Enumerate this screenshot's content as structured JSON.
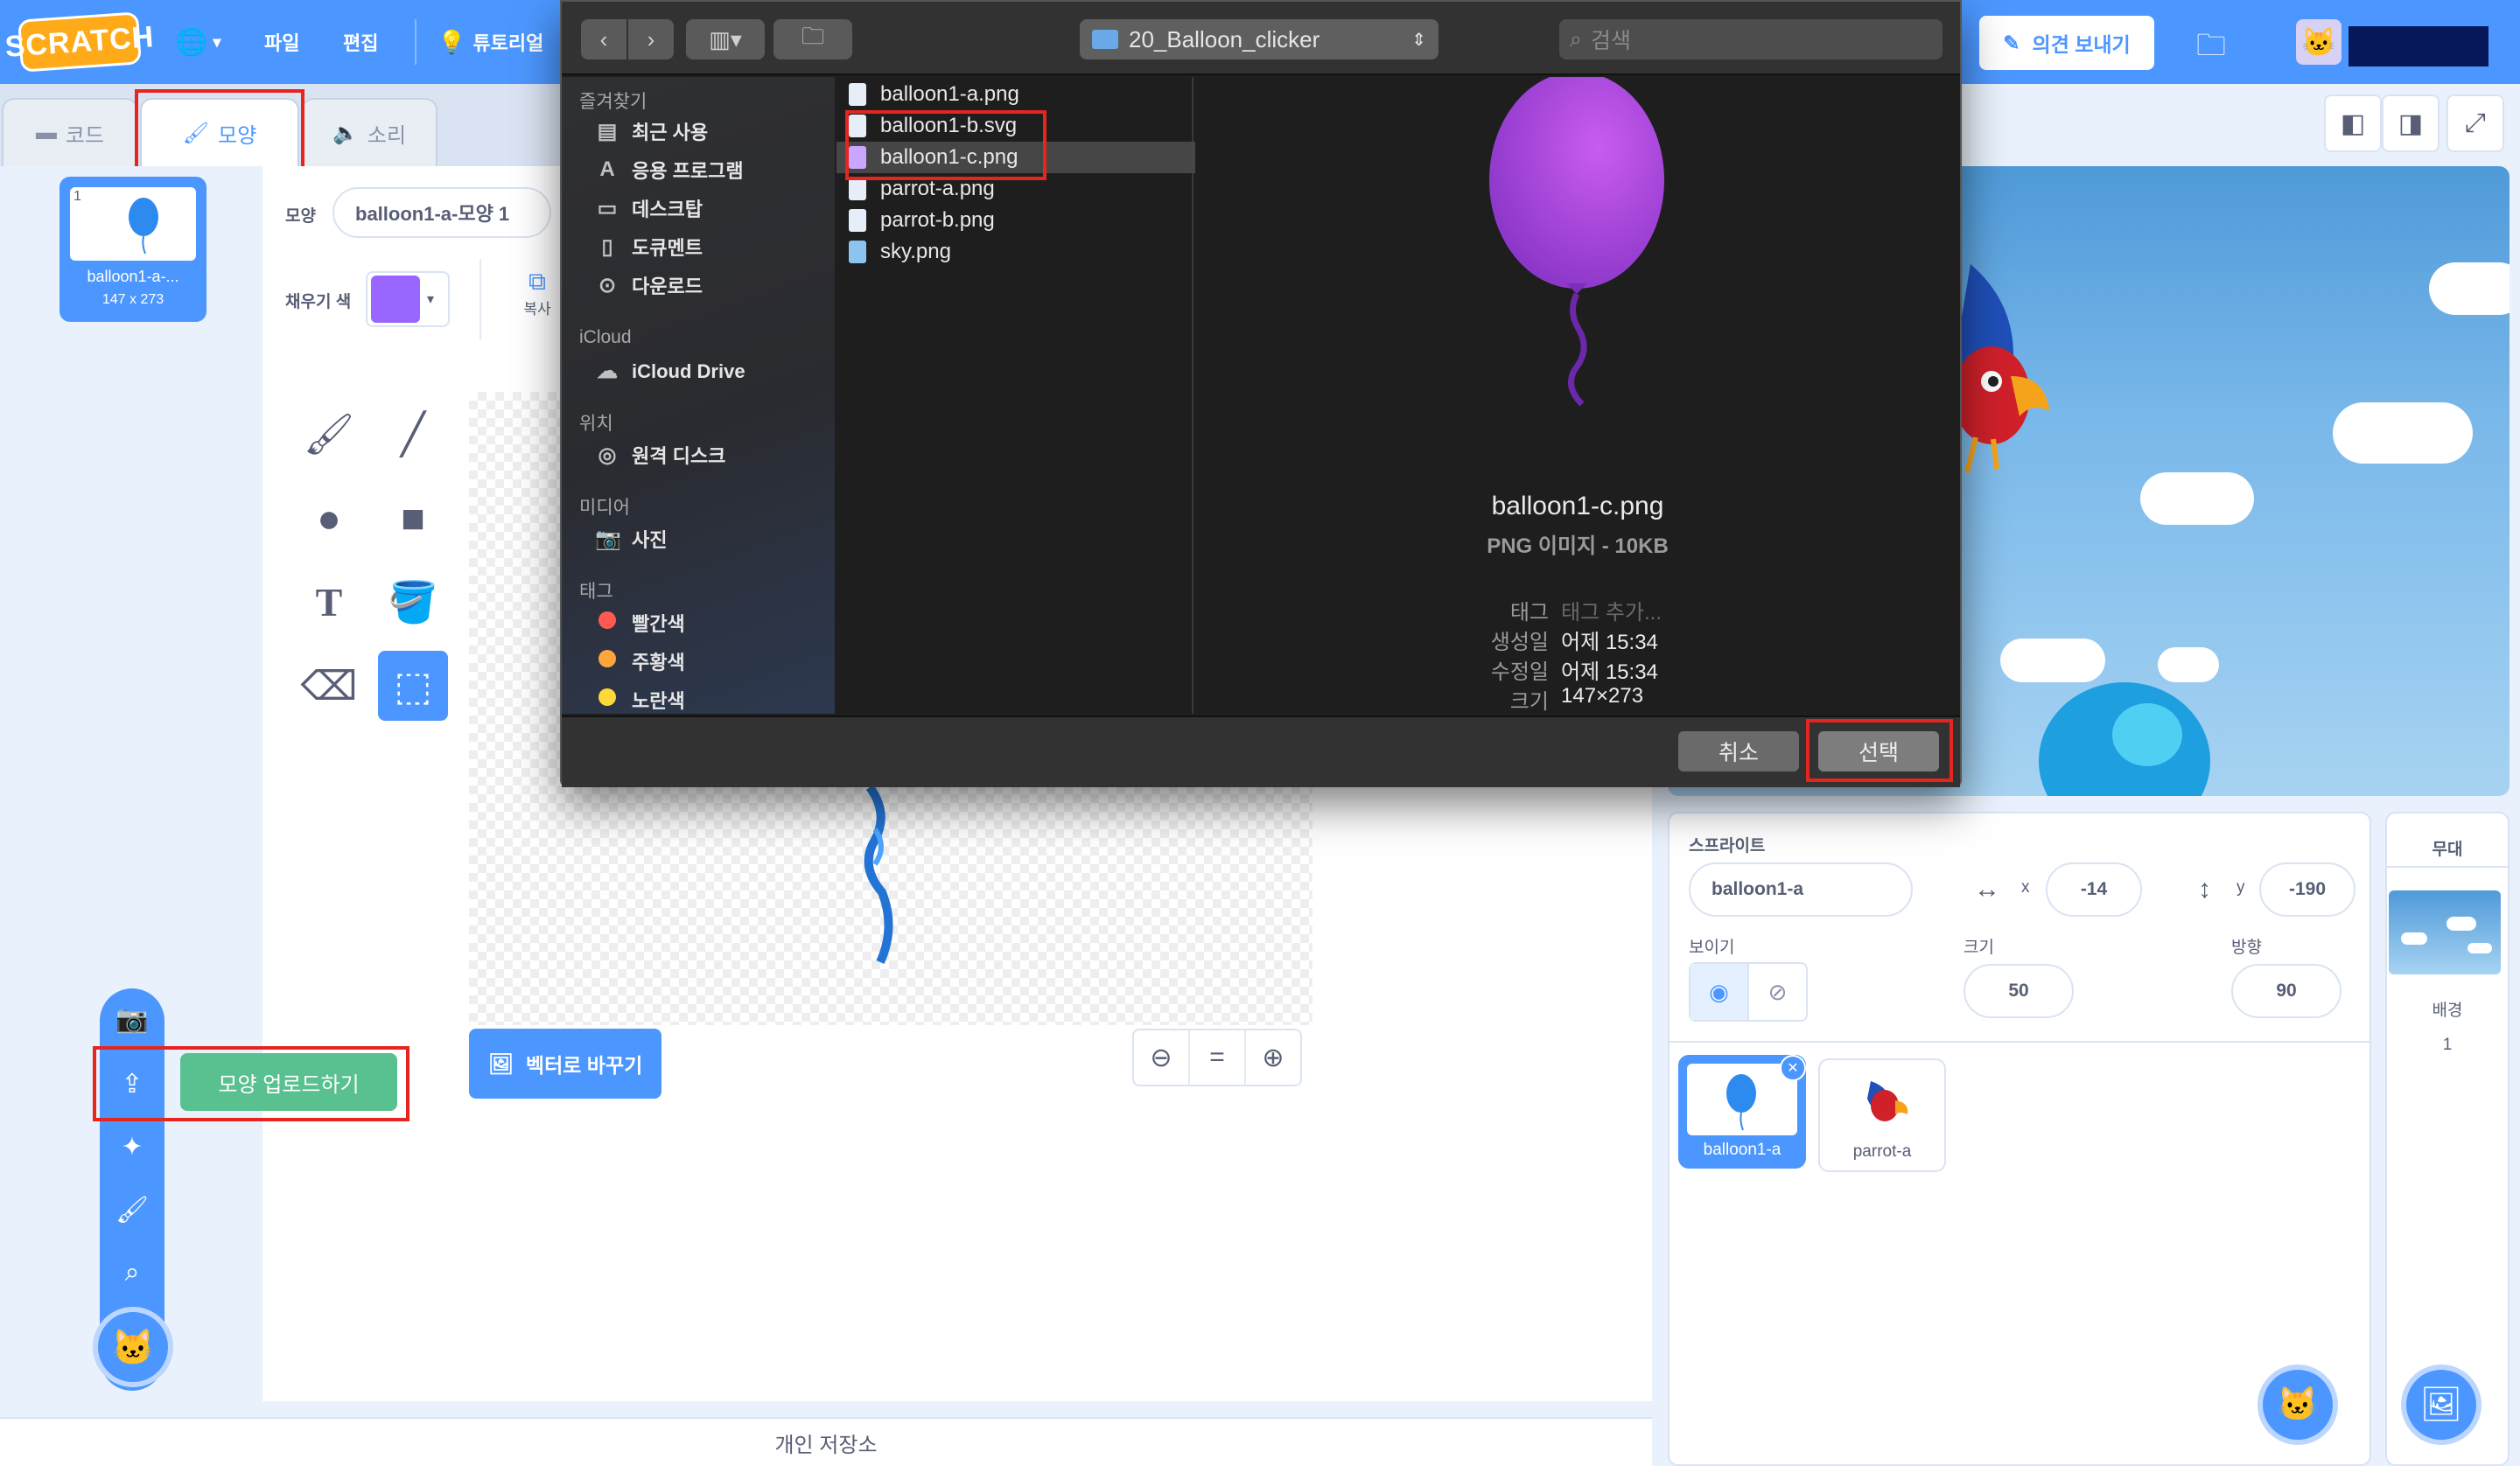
{
  "menubar": {
    "logo": "SCRATCH",
    "file": "파일",
    "edit": "편집",
    "tutorials": "튜토리얼",
    "feedback": "의견 보내기"
  },
  "tabs": {
    "code": "코드",
    "costumes": "모양",
    "sounds": "소리"
  },
  "costume_list": [
    {
      "index": "1",
      "name": "balloon1-a-...",
      "size": "147 x 273"
    }
  ],
  "paint": {
    "costume_label": "모양",
    "costume_name": "balloon1-a-모양 1",
    "fill_label": "채우기 색",
    "fill_color": "#9966ff",
    "copy_label": "복사",
    "convert_button": "벡터로 바꾸기",
    "zoom_reset": "="
  },
  "upload_menu": {
    "tooltip": "모양 업로드하기"
  },
  "backpack": "개인 저장소",
  "sprite_info": {
    "sprite_label": "스프라이트",
    "sprite_name": "balloon1-a",
    "x_label": "x",
    "x_value": "-14",
    "y_label": "y",
    "y_value": "-190",
    "show_label": "보이기",
    "size_label": "크기",
    "size_value": "50",
    "direction_label": "방향",
    "direction_value": "90"
  },
  "sprites": [
    {
      "name": "balloon1-a",
      "selected": true
    },
    {
      "name": "parrot-a",
      "selected": false
    }
  ],
  "stage_panel": {
    "title": "무대",
    "backdrop_label": "배경",
    "backdrop_count": "1"
  },
  "dialog": {
    "folder": "20_Balloon_clicker",
    "search_placeholder": "검색",
    "favorites_header": "즐겨찾기",
    "favorites": [
      "최근 사용",
      "응용 프로그램",
      "데스크탑",
      "도큐멘트",
      "다운로드"
    ],
    "icloud_header": "iCloud",
    "icloud_items": [
      "iCloud Drive"
    ],
    "locations_header": "위치",
    "locations": [
      "원격 디스크"
    ],
    "media_header": "미디어",
    "media": [
      "사진"
    ],
    "tags_header": "태그",
    "tags": [
      {
        "name": "빨간색",
        "color": "#ff5a52"
      },
      {
        "name": "주황색",
        "color": "#ffa53c"
      },
      {
        "name": "노란색",
        "color": "#ffd83a"
      }
    ],
    "files": [
      "balloon1-a.png",
      "balloon1-b.svg",
      "balloon1-c.png",
      "parrot-a.png",
      "parrot-b.png",
      "sky.png"
    ],
    "selected_file": "balloon1-c.png",
    "preview": {
      "name": "balloon1-c.png",
      "kind": "PNG 이미지 - 10KB",
      "tag_label": "태그",
      "tag_value": "태그 추가...",
      "created_label": "생성일",
      "created_value": "어제 15:34",
      "modified_label": "수정일",
      "modified_value": "어제 15:34",
      "size_label": "크기",
      "size_value": "147×273"
    },
    "cancel": "취소",
    "choose": "선택"
  }
}
